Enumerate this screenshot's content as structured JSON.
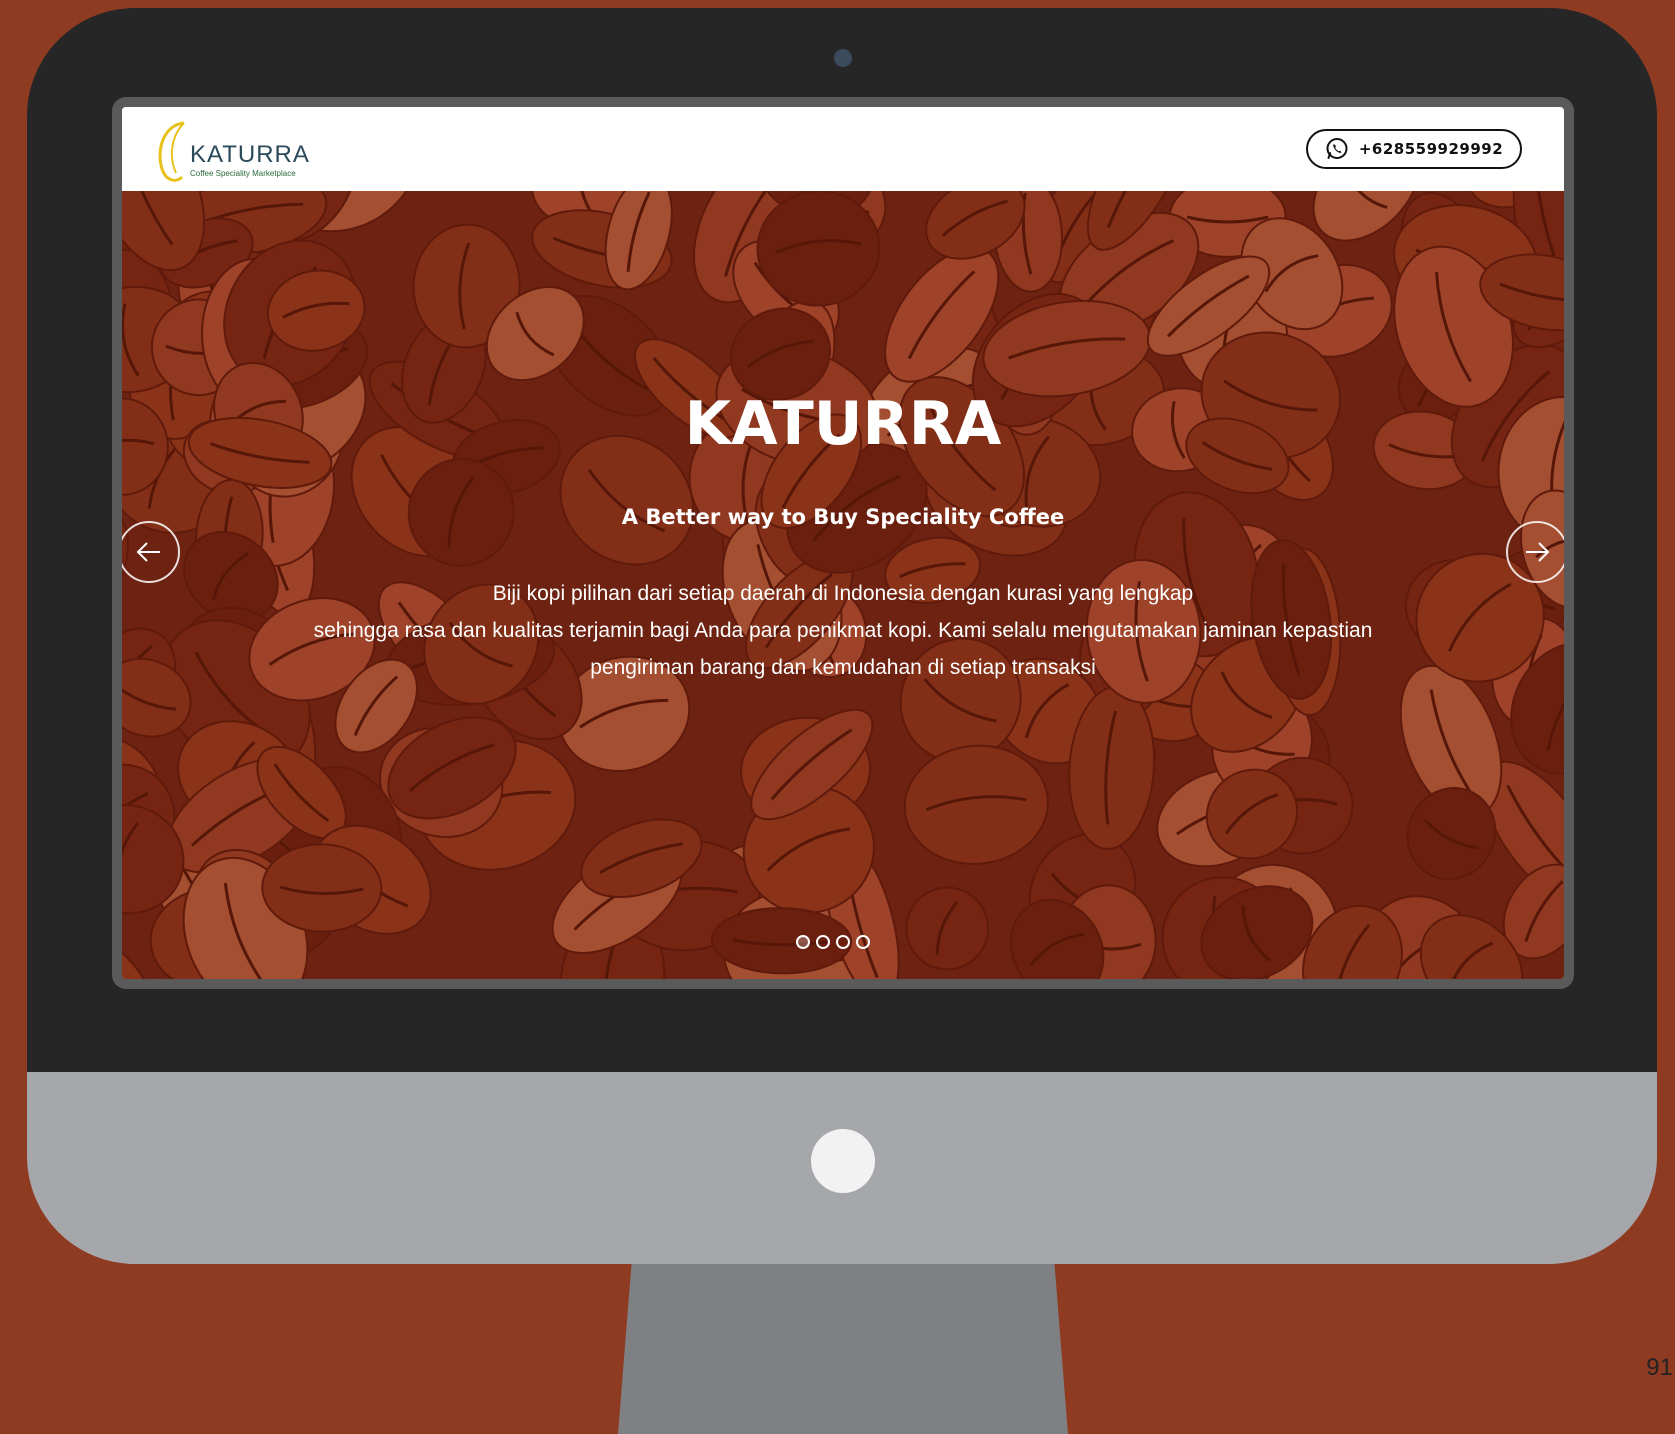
{
  "brand": {
    "logo_text": "KATURRA",
    "logo_tagline": "Coffee Speciality Marketplace"
  },
  "navbar": {
    "phone_number": "+628559929992",
    "phone_icon": "whatsapp-icon"
  },
  "hero": {
    "title": "KATURRA",
    "subtitle": "A Better way to Buy Speciality Coffee",
    "description_lines": [
      "Biji kopi pilihan dari setiap daerah di Indonesia dengan kurasi yang lengkap",
      "sehingga rasa dan kualitas terjamin bagi Anda para penikmat kopi. Kami selalu mengutamakan jaminan kepastian",
      "pengiriman barang dan kemudahan di setiap transaksi"
    ],
    "prev_icon": "arrow-left-icon",
    "next_icon": "arrow-right-icon",
    "slide_count": 4,
    "active_slide": 1
  },
  "page_number": "91",
  "colors": {
    "background": "#8f3b22",
    "bezel": "#262626",
    "chin": "#a6a7aa",
    "stand": "#7e8083",
    "overlay": "#6e2614"
  }
}
